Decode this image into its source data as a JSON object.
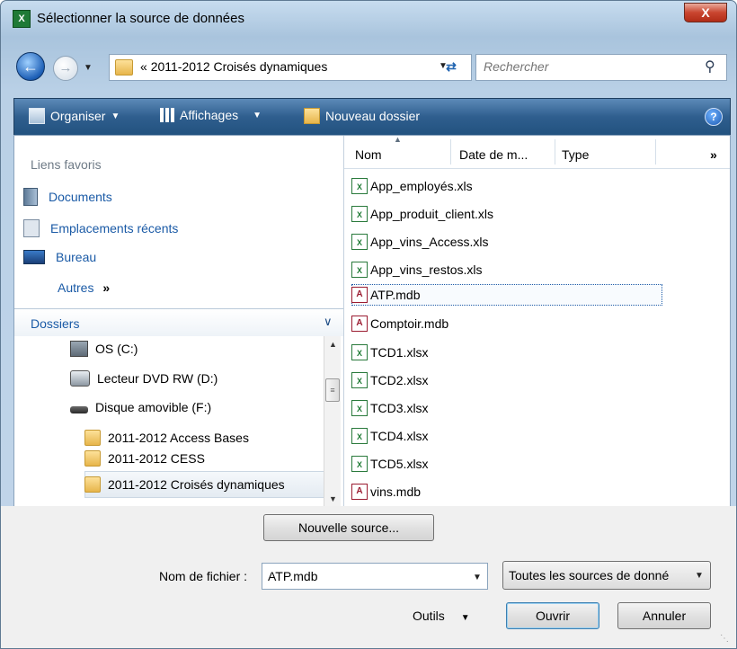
{
  "window": {
    "title": "Sélectionner la source de données",
    "close_label": "X"
  },
  "navigation": {
    "path_prefix": "«",
    "path_text": "2011-2012 Croisés dynamiques",
    "search_placeholder": "Rechercher"
  },
  "toolbar": {
    "organize_label": "Organiser",
    "views_label": "Affichages",
    "new_folder_label": "Nouveau dossier"
  },
  "favorites": {
    "header": "Liens favoris",
    "items": [
      {
        "label": "Documents",
        "icon": "documents-icon"
      },
      {
        "label": "Emplacements récents",
        "icon": "recent-places-icon"
      },
      {
        "label": "Bureau",
        "icon": "desktop-icon"
      }
    ],
    "more_label": "Autres",
    "more_chevron": "»"
  },
  "folders": {
    "header": "Dossiers",
    "tree": [
      {
        "label": "OS (C:)",
        "icon": "drive-icon"
      },
      {
        "label": "Lecteur DVD RW (D:)",
        "icon": "dvd-drive-icon"
      },
      {
        "label": "Disque amovible (F:)",
        "icon": "removable-disk-icon"
      },
      {
        "label": "2011-2012 Access Bases",
        "icon": "folder-icon"
      },
      {
        "label": "2011-2012 CESS",
        "icon": "folder-icon"
      },
      {
        "label": "2011-2012 Croisés dynamiques",
        "icon": "folder-icon",
        "selected": true
      }
    ]
  },
  "file_list": {
    "columns": [
      "Nom",
      "Date de m...",
      "Type"
    ],
    "overflow_chevron": "»",
    "files": [
      {
        "name": "App_employés.xls",
        "type": "xls"
      },
      {
        "name": "App_produit_client.xls",
        "type": "xls"
      },
      {
        "name": "App_vins_Access.xls",
        "type": "xls"
      },
      {
        "name": "App_vins_restos.xls",
        "type": "xls"
      },
      {
        "name": "ATP.mdb",
        "type": "mdb",
        "selected": true
      },
      {
        "name": "Comptoir.mdb",
        "type": "mdb"
      },
      {
        "name": "TCD1.xlsx",
        "type": "xlsx"
      },
      {
        "name": "TCD2.xlsx",
        "type": "xlsx"
      },
      {
        "name": "TCD3.xlsx",
        "type": "xlsx"
      },
      {
        "name": "TCD4.xlsx",
        "type": "xlsx"
      },
      {
        "name": "TCD5.xlsx",
        "type": "xlsx"
      },
      {
        "name": "vins.mdb",
        "type": "mdb"
      }
    ]
  },
  "footer": {
    "new_source_label": "Nouvelle source...",
    "filename_label": "Nom de fichier :",
    "filename_value": "ATP.mdb",
    "filter_value": "Toutes les sources de donné",
    "tools_label": "Outils",
    "open_label": "Ouvrir",
    "cancel_label": "Annuler"
  },
  "colors": {
    "toolbar": "#2f5e8e",
    "link": "#1a5aa6",
    "close_button": "#c9452f"
  }
}
